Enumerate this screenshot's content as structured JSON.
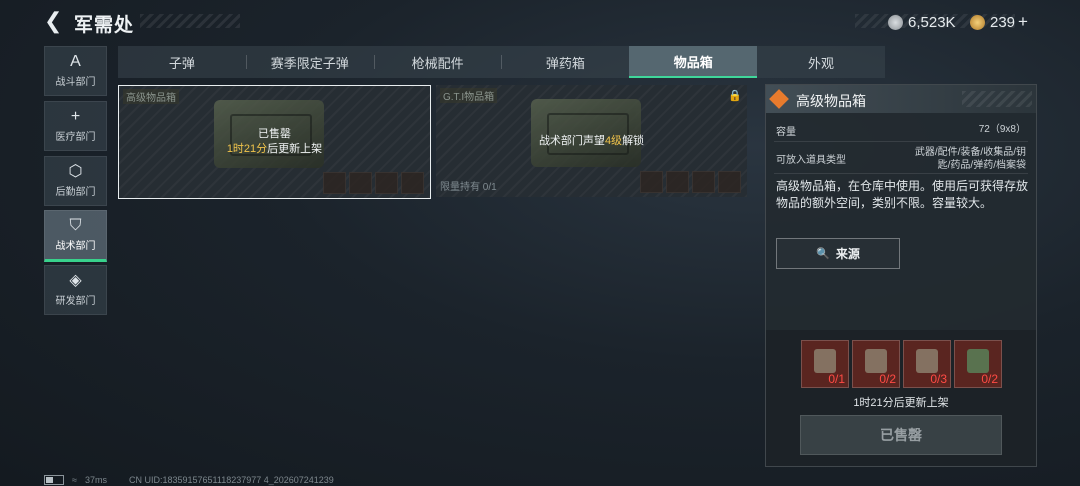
{
  "header": {
    "title": "军需处",
    "currency_1": "6,523K",
    "currency_2": "239",
    "add_label": "+"
  },
  "nav": [
    {
      "label": "战斗部门",
      "icon": "A"
    },
    {
      "label": "医疗部门",
      "icon": "+"
    },
    {
      "label": "后勤部门",
      "icon": "⬡"
    },
    {
      "label": "战术部门",
      "icon": "⛉"
    },
    {
      "label": "研发部门",
      "icon": "◈"
    }
  ],
  "tabs": [
    "子弹",
    "赛季限定子弹",
    "枪械配件",
    "弹药箱",
    "物品箱",
    "外观"
  ],
  "cards": [
    {
      "tag": "高级物品箱",
      "status": "已售罄",
      "timer": "1时21分",
      "timer_suffix": "后更新上架"
    },
    {
      "tag": "G.T.I物品箱",
      "unlock_prefix": "战术部门声望",
      "unlock_level": "4级",
      "unlock_suffix": "解锁",
      "limit": "限量持有 0/1"
    }
  ],
  "panel": {
    "title": "高级物品箱",
    "capacity_label": "容量",
    "capacity_value": "72（9x8）",
    "types_label": "可放入道具类型",
    "types_value_1": "武器/配件/装备/收集品/钥",
    "types_value_2": "匙/药品/弹药/档案袋",
    "description": "高级物品箱，在仓库中使用。使用后可获得存放物品的额外空间，类别不限。容量较大。",
    "source_button": "来源",
    "materials": [
      "0/1",
      "0/2",
      "0/3",
      "0/2"
    ],
    "refresh_text": "1时21分后更新上架",
    "sold_out_button": "已售罄"
  },
  "footer": {
    "ping": "37ms",
    "uid": "CN UID:18359157651118237977 4_202607241239"
  }
}
